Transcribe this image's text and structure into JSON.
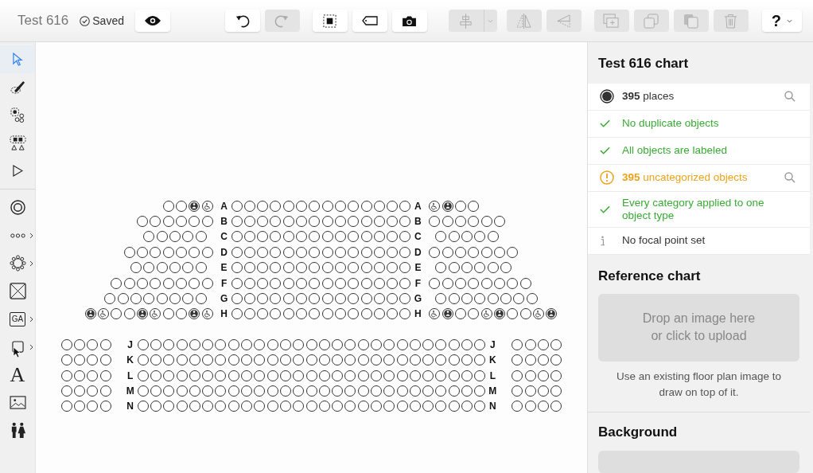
{
  "toolbar": {
    "title": "Test 616",
    "save_status": "Saved",
    "button_groups": [
      [
        {
          "kind": "preview",
          "disabled": false
        }
      ],
      [
        {
          "kind": "undo",
          "disabled": false
        },
        {
          "kind": "redo",
          "disabled": true
        }
      ],
      [
        {
          "kind": "select-all",
          "disabled": false
        },
        {
          "kind": "label",
          "disabled": false
        },
        {
          "kind": "camera",
          "disabled": false
        }
      ],
      [
        {
          "kind": "align",
          "disabled": true
        }
      ],
      [
        {
          "kind": "flip",
          "disabled": true
        },
        {
          "kind": "skew",
          "disabled": true
        }
      ],
      [
        {
          "kind": "add-section",
          "disabled": true
        },
        {
          "kind": "duplicate",
          "disabled": true
        },
        {
          "kind": "copy",
          "disabled": true
        },
        {
          "kind": "delete",
          "disabled": true
        }
      ]
    ],
    "help": {
      "label": "?"
    }
  },
  "tools": [
    {
      "kind": "select",
      "selected": true
    },
    {
      "kind": "brush",
      "selected": false
    },
    {
      "kind": "seat-select",
      "selected": false
    },
    {
      "kind": "group-select",
      "selected": false
    },
    {
      "kind": "node-select",
      "selected": false
    },
    {
      "kind": "separator"
    },
    {
      "kind": "seat",
      "selected": false
    },
    {
      "kind": "row",
      "selected": false,
      "submenu": true
    },
    {
      "kind": "table",
      "selected": false,
      "submenu": true
    },
    {
      "kind": "booth",
      "selected": false
    },
    {
      "kind": "ga",
      "label": "GA",
      "selected": false,
      "submenu": true
    },
    {
      "kind": "shape",
      "selected": false,
      "submenu": true
    },
    {
      "kind": "text",
      "label": "A",
      "selected": false
    },
    {
      "kind": "image",
      "selected": false
    },
    {
      "kind": "restroom",
      "selected": false
    }
  ],
  "seating": [
    {
      "rows": [
        {
          "label_left": "A",
          "label_right": "A",
          "staggered": false,
          "left": [
            {
              "kind": "seat"
            },
            {
              "kind": "seat"
            },
            {
              "kind": "companion"
            },
            {
              "kind": "wheelchair"
            }
          ],
          "middle": [
            {
              "kind": "seat"
            },
            {
              "kind": "seat"
            },
            {
              "kind": "seat"
            },
            {
              "kind": "seat"
            },
            {
              "kind": "seat"
            },
            {
              "kind": "seat"
            },
            {
              "kind": "seat"
            },
            {
              "kind": "seat"
            },
            {
              "kind": "seat"
            },
            {
              "kind": "seat"
            },
            {
              "kind": "seat"
            },
            {
              "kind": "seat"
            },
            {
              "kind": "seat"
            },
            {
              "kind": "seat"
            }
          ],
          "right": [
            {
              "kind": "wheelchair"
            },
            {
              "kind": "companion"
            },
            {
              "kind": "seat"
            },
            {
              "kind": "seat"
            }
          ]
        },
        {
          "label_left": "B",
          "label_right": "B",
          "staggered": false,
          "left": [
            {
              "kind": "seat"
            },
            {
              "kind": "seat"
            },
            {
              "kind": "seat"
            },
            {
              "kind": "seat"
            },
            {
              "kind": "seat"
            },
            {
              "kind": "seat"
            }
          ],
          "middle": [
            {
              "kind": "seat"
            },
            {
              "kind": "seat"
            },
            {
              "kind": "seat"
            },
            {
              "kind": "seat"
            },
            {
              "kind": "seat"
            },
            {
              "kind": "seat"
            },
            {
              "kind": "seat"
            },
            {
              "kind": "seat"
            },
            {
              "kind": "seat"
            },
            {
              "kind": "seat"
            },
            {
              "kind": "seat"
            },
            {
              "kind": "seat"
            },
            {
              "kind": "seat"
            },
            {
              "kind": "seat"
            }
          ],
          "right": [
            {
              "kind": "seat"
            },
            {
              "kind": "seat"
            },
            {
              "kind": "seat"
            },
            {
              "kind": "seat"
            },
            {
              "kind": "seat"
            },
            {
              "kind": "seat"
            }
          ]
        },
        {
          "label_left": "C",
          "label_right": "C",
          "staggered": true,
          "left": [
            {
              "kind": "seat"
            },
            {
              "kind": "seat"
            },
            {
              "kind": "seat"
            },
            {
              "kind": "seat"
            },
            {
              "kind": "seat"
            }
          ],
          "middle": [
            {
              "kind": "seat"
            },
            {
              "kind": "seat"
            },
            {
              "kind": "seat"
            },
            {
              "kind": "seat"
            },
            {
              "kind": "seat"
            },
            {
              "kind": "seat"
            },
            {
              "kind": "seat"
            },
            {
              "kind": "seat"
            },
            {
              "kind": "seat"
            },
            {
              "kind": "seat"
            },
            {
              "kind": "seat"
            },
            {
              "kind": "seat"
            },
            {
              "kind": "seat"
            },
            {
              "kind": "seat"
            }
          ],
          "right": [
            {
              "kind": "seat"
            },
            {
              "kind": "seat"
            },
            {
              "kind": "seat"
            },
            {
              "kind": "seat"
            },
            {
              "kind": "seat"
            }
          ]
        },
        {
          "label_left": "D",
          "label_right": "D",
          "staggered": false,
          "left": [
            {
              "kind": "seat"
            },
            {
              "kind": "seat"
            },
            {
              "kind": "seat"
            },
            {
              "kind": "seat"
            },
            {
              "kind": "seat"
            },
            {
              "kind": "seat"
            },
            {
              "kind": "seat"
            }
          ],
          "middle": [
            {
              "kind": "seat"
            },
            {
              "kind": "seat"
            },
            {
              "kind": "seat"
            },
            {
              "kind": "seat"
            },
            {
              "kind": "seat"
            },
            {
              "kind": "seat"
            },
            {
              "kind": "seat"
            },
            {
              "kind": "seat"
            },
            {
              "kind": "seat"
            },
            {
              "kind": "seat"
            },
            {
              "kind": "seat"
            },
            {
              "kind": "seat"
            },
            {
              "kind": "seat"
            },
            {
              "kind": "seat"
            }
          ],
          "right": [
            {
              "kind": "seat"
            },
            {
              "kind": "seat"
            },
            {
              "kind": "seat"
            },
            {
              "kind": "seat"
            },
            {
              "kind": "seat"
            },
            {
              "kind": "seat"
            },
            {
              "kind": "seat"
            }
          ]
        },
        {
          "label_left": "E",
          "label_right": "E",
          "staggered": true,
          "left": [
            {
              "kind": "seat"
            },
            {
              "kind": "seat"
            },
            {
              "kind": "seat"
            },
            {
              "kind": "seat"
            },
            {
              "kind": "seat"
            },
            {
              "kind": "seat"
            }
          ],
          "middle": [
            {
              "kind": "seat"
            },
            {
              "kind": "seat"
            },
            {
              "kind": "seat"
            },
            {
              "kind": "seat"
            },
            {
              "kind": "seat"
            },
            {
              "kind": "seat"
            },
            {
              "kind": "seat"
            },
            {
              "kind": "seat"
            },
            {
              "kind": "seat"
            },
            {
              "kind": "seat"
            },
            {
              "kind": "seat"
            },
            {
              "kind": "seat"
            },
            {
              "kind": "seat"
            },
            {
              "kind": "seat"
            }
          ],
          "right": [
            {
              "kind": "seat"
            },
            {
              "kind": "seat"
            },
            {
              "kind": "seat"
            },
            {
              "kind": "seat"
            },
            {
              "kind": "seat"
            },
            {
              "kind": "seat"
            }
          ]
        },
        {
          "label_left": "F",
          "label_right": "F",
          "staggered": false,
          "left": [
            {
              "kind": "seat"
            },
            {
              "kind": "seat"
            },
            {
              "kind": "seat"
            },
            {
              "kind": "seat"
            },
            {
              "kind": "seat"
            },
            {
              "kind": "seat"
            },
            {
              "kind": "seat"
            },
            {
              "kind": "seat"
            }
          ],
          "middle": [
            {
              "kind": "seat"
            },
            {
              "kind": "seat"
            },
            {
              "kind": "seat"
            },
            {
              "kind": "seat"
            },
            {
              "kind": "seat"
            },
            {
              "kind": "seat"
            },
            {
              "kind": "seat"
            },
            {
              "kind": "seat"
            },
            {
              "kind": "seat"
            },
            {
              "kind": "seat"
            },
            {
              "kind": "seat"
            },
            {
              "kind": "seat"
            },
            {
              "kind": "seat"
            },
            {
              "kind": "seat"
            }
          ],
          "right": [
            {
              "kind": "seat"
            },
            {
              "kind": "seat"
            },
            {
              "kind": "seat"
            },
            {
              "kind": "seat"
            },
            {
              "kind": "seat"
            },
            {
              "kind": "seat"
            },
            {
              "kind": "seat"
            },
            {
              "kind": "seat"
            }
          ]
        },
        {
          "label_left": "G",
          "label_right": "G",
          "staggered": true,
          "left": [
            {
              "kind": "seat"
            },
            {
              "kind": "seat"
            },
            {
              "kind": "seat"
            },
            {
              "kind": "seat"
            },
            {
              "kind": "seat"
            },
            {
              "kind": "seat"
            },
            {
              "kind": "seat"
            },
            {
              "kind": "seat"
            }
          ],
          "middle": [
            {
              "kind": "seat"
            },
            {
              "kind": "seat"
            },
            {
              "kind": "seat"
            },
            {
              "kind": "seat"
            },
            {
              "kind": "seat"
            },
            {
              "kind": "seat"
            },
            {
              "kind": "seat"
            },
            {
              "kind": "seat"
            },
            {
              "kind": "seat"
            },
            {
              "kind": "seat"
            },
            {
              "kind": "seat"
            },
            {
              "kind": "seat"
            },
            {
              "kind": "seat"
            },
            {
              "kind": "seat"
            }
          ],
          "right": [
            {
              "kind": "seat"
            },
            {
              "kind": "seat"
            },
            {
              "kind": "seat"
            },
            {
              "kind": "seat"
            },
            {
              "kind": "seat"
            },
            {
              "kind": "seat"
            },
            {
              "kind": "seat"
            },
            {
              "kind": "seat"
            }
          ]
        },
        {
          "label_left": "H",
          "label_right": "H",
          "staggered": false,
          "left": [
            {
              "kind": "companion"
            },
            {
              "kind": "wheelchair"
            },
            {
              "kind": "seat"
            },
            {
              "kind": "seat"
            },
            {
              "kind": "companion"
            },
            {
              "kind": "wheelchair"
            },
            {
              "kind": "seat"
            },
            {
              "kind": "seat"
            },
            {
              "kind": "companion"
            },
            {
              "kind": "wheelchair"
            }
          ],
          "middle": [
            {
              "kind": "seat"
            },
            {
              "kind": "seat"
            },
            {
              "kind": "seat"
            },
            {
              "kind": "seat"
            },
            {
              "kind": "seat"
            },
            {
              "kind": "seat"
            },
            {
              "kind": "seat"
            },
            {
              "kind": "seat"
            },
            {
              "kind": "seat"
            },
            {
              "kind": "seat"
            },
            {
              "kind": "seat"
            },
            {
              "kind": "seat"
            },
            {
              "kind": "seat"
            },
            {
              "kind": "seat"
            }
          ],
          "right": [
            {
              "kind": "wheelchair"
            },
            {
              "kind": "companion"
            },
            {
              "kind": "seat"
            },
            {
              "kind": "seat"
            },
            {
              "kind": "wheelchair"
            },
            {
              "kind": "companion"
            },
            {
              "kind": "seat"
            },
            {
              "kind": "seat"
            },
            {
              "kind": "wheelchair"
            },
            {
              "kind": "companion"
            }
          ]
        }
      ]
    },
    {
      "rows": [
        {
          "label_left": "J",
          "label_right": "J",
          "staggered": false,
          "left": [
            {
              "kind": "seat"
            },
            {
              "kind": "seat"
            },
            {
              "kind": "seat"
            },
            {
              "kind": "seat"
            }
          ],
          "middle": [
            {
              "kind": "seat"
            },
            {
              "kind": "seat"
            },
            {
              "kind": "seat"
            },
            {
              "kind": "seat"
            },
            {
              "kind": "seat"
            },
            {
              "kind": "seat"
            },
            {
              "kind": "seat"
            },
            {
              "kind": "seat"
            },
            {
              "kind": "seat"
            },
            {
              "kind": "seat"
            },
            {
              "kind": "seat"
            },
            {
              "kind": "seat"
            },
            {
              "kind": "seat"
            },
            {
              "kind": "seat"
            },
            {
              "kind": "seat"
            },
            {
              "kind": "seat"
            },
            {
              "kind": "seat"
            },
            {
              "kind": "seat"
            },
            {
              "kind": "seat"
            },
            {
              "kind": "seat"
            },
            {
              "kind": "seat"
            },
            {
              "kind": "seat"
            },
            {
              "kind": "seat"
            },
            {
              "kind": "seat"
            },
            {
              "kind": "seat"
            },
            {
              "kind": "seat"
            },
            {
              "kind": "seat"
            }
          ],
          "right": [
            {
              "kind": "seat"
            },
            {
              "kind": "seat"
            },
            {
              "kind": "seat"
            },
            {
              "kind": "seat"
            }
          ]
        },
        {
          "label_left": "K",
          "label_right": "K",
          "staggered": false,
          "left": [
            {
              "kind": "seat"
            },
            {
              "kind": "seat"
            },
            {
              "kind": "seat"
            },
            {
              "kind": "seat"
            }
          ],
          "middle": [
            {
              "kind": "seat"
            },
            {
              "kind": "seat"
            },
            {
              "kind": "seat"
            },
            {
              "kind": "seat"
            },
            {
              "kind": "seat"
            },
            {
              "kind": "seat"
            },
            {
              "kind": "seat"
            },
            {
              "kind": "seat"
            },
            {
              "kind": "seat"
            },
            {
              "kind": "seat"
            },
            {
              "kind": "seat"
            },
            {
              "kind": "seat"
            },
            {
              "kind": "seat"
            },
            {
              "kind": "seat"
            },
            {
              "kind": "seat"
            },
            {
              "kind": "seat"
            },
            {
              "kind": "seat"
            },
            {
              "kind": "seat"
            },
            {
              "kind": "seat"
            },
            {
              "kind": "seat"
            },
            {
              "kind": "seat"
            },
            {
              "kind": "seat"
            },
            {
              "kind": "seat"
            },
            {
              "kind": "seat"
            },
            {
              "kind": "seat"
            },
            {
              "kind": "seat"
            },
            {
              "kind": "seat"
            }
          ],
          "right": [
            {
              "kind": "seat"
            },
            {
              "kind": "seat"
            },
            {
              "kind": "seat"
            },
            {
              "kind": "seat"
            }
          ]
        },
        {
          "label_left": "L",
          "label_right": "L",
          "staggered": false,
          "left": [
            {
              "kind": "seat"
            },
            {
              "kind": "seat"
            },
            {
              "kind": "seat"
            },
            {
              "kind": "seat"
            }
          ],
          "middle": [
            {
              "kind": "seat"
            },
            {
              "kind": "seat"
            },
            {
              "kind": "seat"
            },
            {
              "kind": "seat"
            },
            {
              "kind": "seat"
            },
            {
              "kind": "seat"
            },
            {
              "kind": "seat"
            },
            {
              "kind": "seat"
            },
            {
              "kind": "seat"
            },
            {
              "kind": "seat"
            },
            {
              "kind": "seat"
            },
            {
              "kind": "seat"
            },
            {
              "kind": "seat"
            },
            {
              "kind": "seat"
            },
            {
              "kind": "seat"
            },
            {
              "kind": "seat"
            },
            {
              "kind": "seat"
            },
            {
              "kind": "seat"
            },
            {
              "kind": "seat"
            },
            {
              "kind": "seat"
            },
            {
              "kind": "seat"
            },
            {
              "kind": "seat"
            },
            {
              "kind": "seat"
            },
            {
              "kind": "seat"
            },
            {
              "kind": "seat"
            },
            {
              "kind": "seat"
            },
            {
              "kind": "seat"
            }
          ],
          "right": [
            {
              "kind": "seat"
            },
            {
              "kind": "seat"
            },
            {
              "kind": "seat"
            },
            {
              "kind": "seat"
            }
          ]
        },
        {
          "label_left": "M",
          "label_right": "M",
          "staggered": false,
          "left": [
            {
              "kind": "seat"
            },
            {
              "kind": "seat"
            },
            {
              "kind": "seat"
            },
            {
              "kind": "seat"
            }
          ],
          "middle": [
            {
              "kind": "seat"
            },
            {
              "kind": "seat"
            },
            {
              "kind": "seat"
            },
            {
              "kind": "seat"
            },
            {
              "kind": "seat"
            },
            {
              "kind": "seat"
            },
            {
              "kind": "seat"
            },
            {
              "kind": "seat"
            },
            {
              "kind": "seat"
            },
            {
              "kind": "seat"
            },
            {
              "kind": "seat"
            },
            {
              "kind": "seat"
            },
            {
              "kind": "seat"
            },
            {
              "kind": "seat"
            },
            {
              "kind": "seat"
            },
            {
              "kind": "seat"
            },
            {
              "kind": "seat"
            },
            {
              "kind": "seat"
            },
            {
              "kind": "seat"
            },
            {
              "kind": "seat"
            },
            {
              "kind": "seat"
            },
            {
              "kind": "seat"
            },
            {
              "kind": "seat"
            },
            {
              "kind": "seat"
            },
            {
              "kind": "seat"
            },
            {
              "kind": "seat"
            },
            {
              "kind": "seat"
            }
          ],
          "right": [
            {
              "kind": "seat"
            },
            {
              "kind": "seat"
            },
            {
              "kind": "seat"
            },
            {
              "kind": "seat"
            }
          ]
        },
        {
          "label_left": "N",
          "label_right": "N",
          "staggered": false,
          "left": [
            {
              "kind": "seat"
            },
            {
              "kind": "seat"
            },
            {
              "kind": "seat"
            },
            {
              "kind": "seat"
            }
          ],
          "middle": [
            {
              "kind": "seat"
            },
            {
              "kind": "seat"
            },
            {
              "kind": "seat"
            },
            {
              "kind": "seat"
            },
            {
              "kind": "seat"
            },
            {
              "kind": "seat"
            },
            {
              "kind": "seat"
            },
            {
              "kind": "seat"
            },
            {
              "kind": "seat"
            },
            {
              "kind": "seat"
            },
            {
              "kind": "seat"
            },
            {
              "kind": "seat"
            },
            {
              "kind": "seat"
            },
            {
              "kind": "seat"
            },
            {
              "kind": "seat"
            },
            {
              "kind": "seat"
            },
            {
              "kind": "seat"
            },
            {
              "kind": "seat"
            },
            {
              "kind": "seat"
            },
            {
              "kind": "seat"
            },
            {
              "kind": "seat"
            },
            {
              "kind": "seat"
            },
            {
              "kind": "seat"
            },
            {
              "kind": "seat"
            },
            {
              "kind": "seat"
            },
            {
              "kind": "seat"
            },
            {
              "kind": "seat"
            }
          ],
          "right": [
            {
              "kind": "seat"
            },
            {
              "kind": "seat"
            },
            {
              "kind": "seat"
            },
            {
              "kind": "seat"
            }
          ]
        }
      ]
    }
  ],
  "panel": {
    "title": "Test 616 chart",
    "checks": [
      {
        "kind": "places",
        "text": "**395** places",
        "search": true
      },
      {
        "kind": "ok",
        "text": "No duplicate objects",
        "search": false
      },
      {
        "kind": "ok",
        "text": "All objects are labeled",
        "search": false
      },
      {
        "kind": "warning",
        "text": "**395** uncategorized objects",
        "search": true
      },
      {
        "kind": "ok",
        "text": "Every category applied to one object type",
        "search": false
      },
      {
        "kind": "info",
        "text": "No focal point set",
        "search": false
      }
    ],
    "reference": {
      "title": "Reference chart",
      "dropzone": [
        "Drop an image here",
        "or click to upload"
      ],
      "hint": "Use an existing floor plan image to draw on top of it."
    },
    "background": {
      "title": "Background"
    }
  }
}
